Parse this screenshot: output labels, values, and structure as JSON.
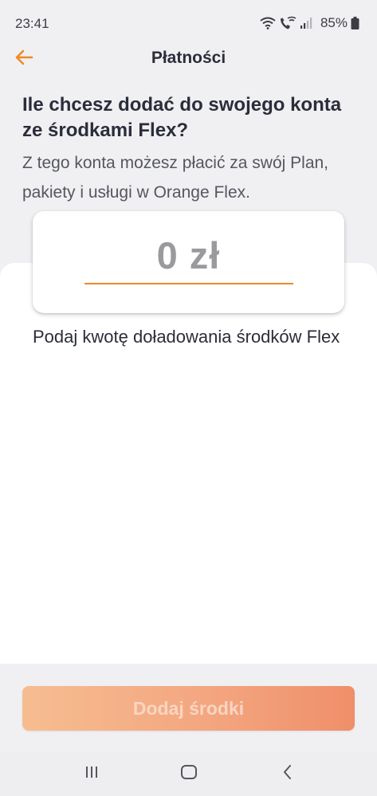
{
  "status_bar": {
    "time": "23:41",
    "battery": "85%",
    "icons": [
      "wifi-icon",
      "wifi-call-icon",
      "signal-icon",
      "battery-icon"
    ]
  },
  "header": {
    "back_icon": "arrow-left-icon",
    "title": "Płatności"
  },
  "headline": "Ile chcesz dodać do swojego konta ze środkami Flex?",
  "subtext": "Z tego konta możesz płacić za swój Plan, pakiety i usługi w Orange Flex.",
  "amount": {
    "value": "0 zł"
  },
  "hint": "Podaj kwotę doładowania środków Flex",
  "submit": {
    "label": "Dodaj środki"
  },
  "nav": {
    "icons": [
      "recent-apps-icon",
      "home-icon",
      "back-icon"
    ]
  },
  "colors": {
    "accent": "#ef8a24",
    "text_dark": "#2b2d3a",
    "background": "#f0f0f3"
  }
}
